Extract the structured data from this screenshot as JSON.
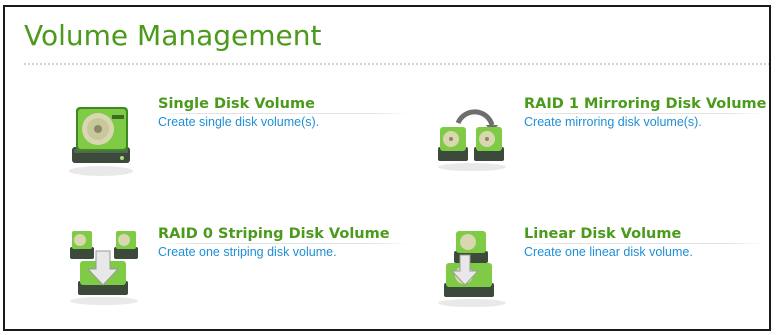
{
  "page": {
    "title": "Volume Management"
  },
  "options": [
    {
      "label": "Single Disk Volume",
      "description": "Create single disk volume(s).",
      "icon": "single-disk-icon"
    },
    {
      "label": "RAID 1 Mirroring Disk Volume",
      "description": "Create mirroring disk volume(s).",
      "icon": "raid1-mirroring-icon"
    },
    {
      "label": "RAID 0 Striping Disk Volume",
      "description": "Create one striping disk volume.",
      "icon": "raid0-striping-icon"
    },
    {
      "label": "Linear Disk Volume",
      "description": "Create one linear disk volume.",
      "icon": "linear-disk-icon"
    }
  ],
  "colors": {
    "title": "#4c9a1c",
    "label": "#4a9a1c",
    "description": "#1f8fd6",
    "disk_green": "#6cc13a",
    "disk_body": "#3d4a3a"
  }
}
